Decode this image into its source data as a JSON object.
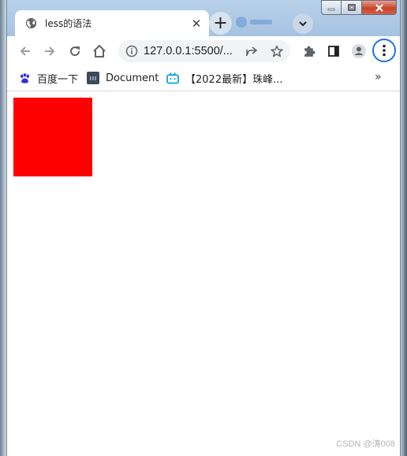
{
  "tab": {
    "title": "less的语法",
    "close": "✕"
  },
  "newtab": "+",
  "toolbar": {
    "url": "127.0.0.1:5500/..."
  },
  "bookmarks": {
    "items": [
      {
        "label": "百度一下",
        "icon": "baidu-paw-icon"
      },
      {
        "label": "Document",
        "icon": "document-icon"
      },
      {
        "label": "【2022最新】珠峰...",
        "icon": "bilibili-icon"
      }
    ],
    "more": "»"
  },
  "page": {
    "box_color": "#ff0000"
  },
  "watermark": "CSDN @涛008"
}
